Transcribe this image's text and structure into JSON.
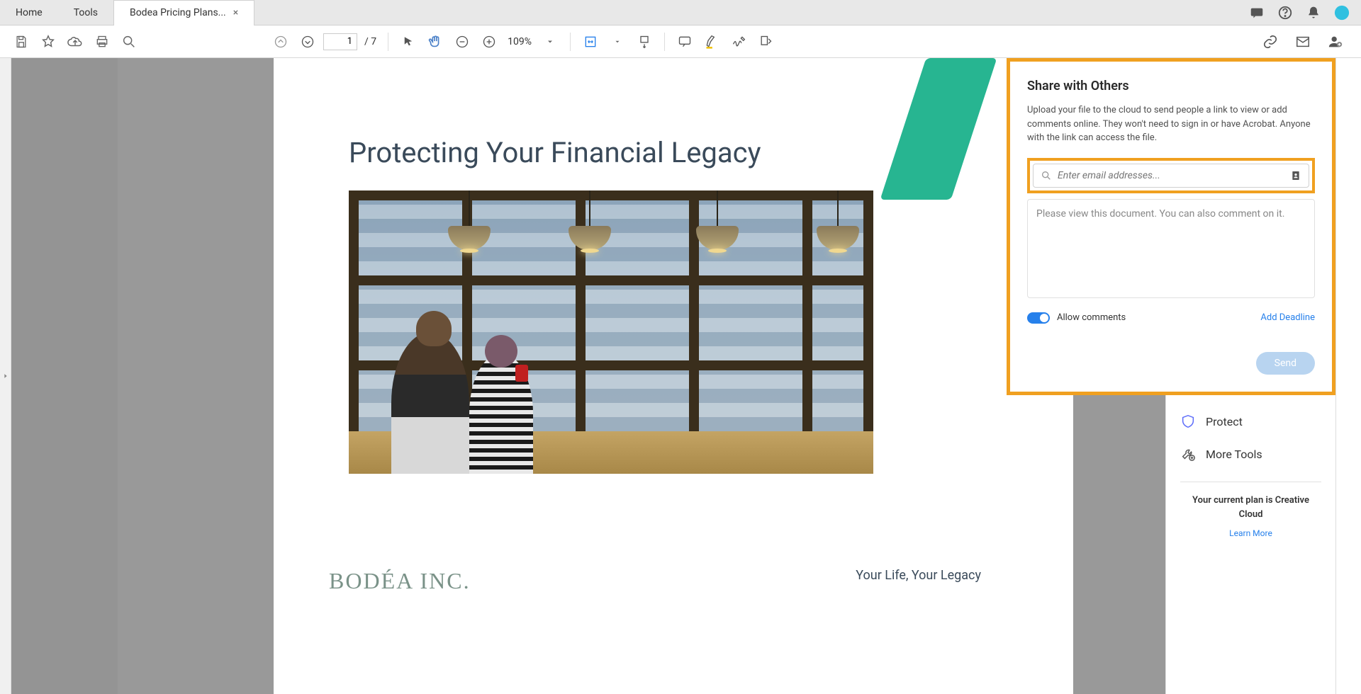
{
  "tabs": {
    "home": "Home",
    "tools": "Tools",
    "doc_tab": "Bodea Pricing Plans..."
  },
  "toolbar": {
    "page_current": "1",
    "page_total": "/  7",
    "zoom": "109%"
  },
  "document": {
    "title": "Protecting Your Financial Legacy",
    "tagline": "Your Life, Your Legacy",
    "logo": "BODÉA INC."
  },
  "share_panel": {
    "title": "Share with Others",
    "description": "Upload your file to the cloud to send people a link to view or add comments online. They won't need to sign in or have Acrobat. Anyone with the link can access the file.",
    "email_placeholder": "Enter email addresses...",
    "message_text": "Please view this document. You can also comment on it.",
    "allow_comments": "Allow comments",
    "add_deadline": "Add Deadline",
    "send": "Send"
  },
  "tools_panel": {
    "protect": "Protect",
    "more_tools": "More Tools",
    "plan_text": "Your current plan is Creative Cloud",
    "learn_more": "Learn More"
  }
}
